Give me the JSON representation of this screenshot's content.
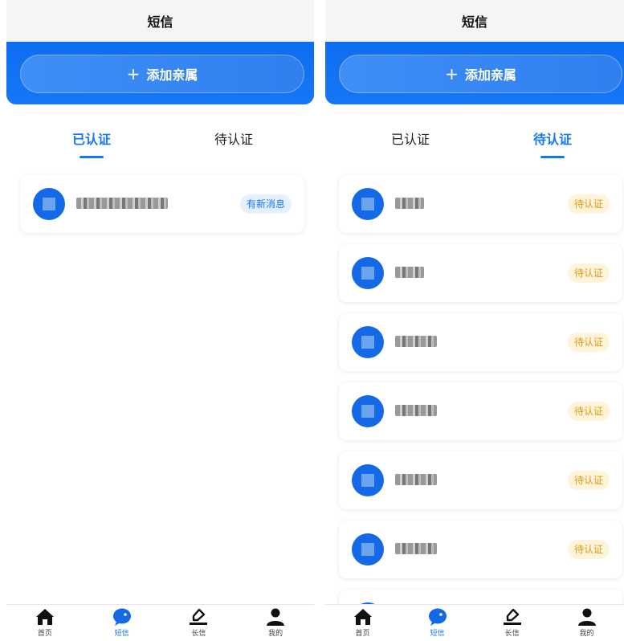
{
  "title": "短信",
  "add_button": {
    "plus": "+",
    "label": "添加亲属"
  },
  "tabs": [
    "已认证",
    "待认证"
  ],
  "left_screen": {
    "active_tab": 0,
    "contacts": [
      {
        "badge": "有新消息"
      }
    ]
  },
  "right_screen": {
    "active_tab": 1,
    "contacts": [
      {
        "badge": "待认证"
      },
      {
        "badge": "待认证"
      },
      {
        "badge": "待认证"
      },
      {
        "badge": "待认证"
      },
      {
        "badge": "待认证"
      },
      {
        "badge": "待认证"
      }
    ]
  },
  "tabbar": [
    {
      "label": "首页",
      "icon": "home-icon"
    },
    {
      "label": "短信",
      "icon": "chat-icon"
    },
    {
      "label": "长信",
      "icon": "pen-icon"
    },
    {
      "label": "我的",
      "icon": "user-icon"
    }
  ],
  "colors": {
    "accent": "#1677f5",
    "pending_badge": "#fff4d9",
    "pending_text": "#d99a16"
  }
}
